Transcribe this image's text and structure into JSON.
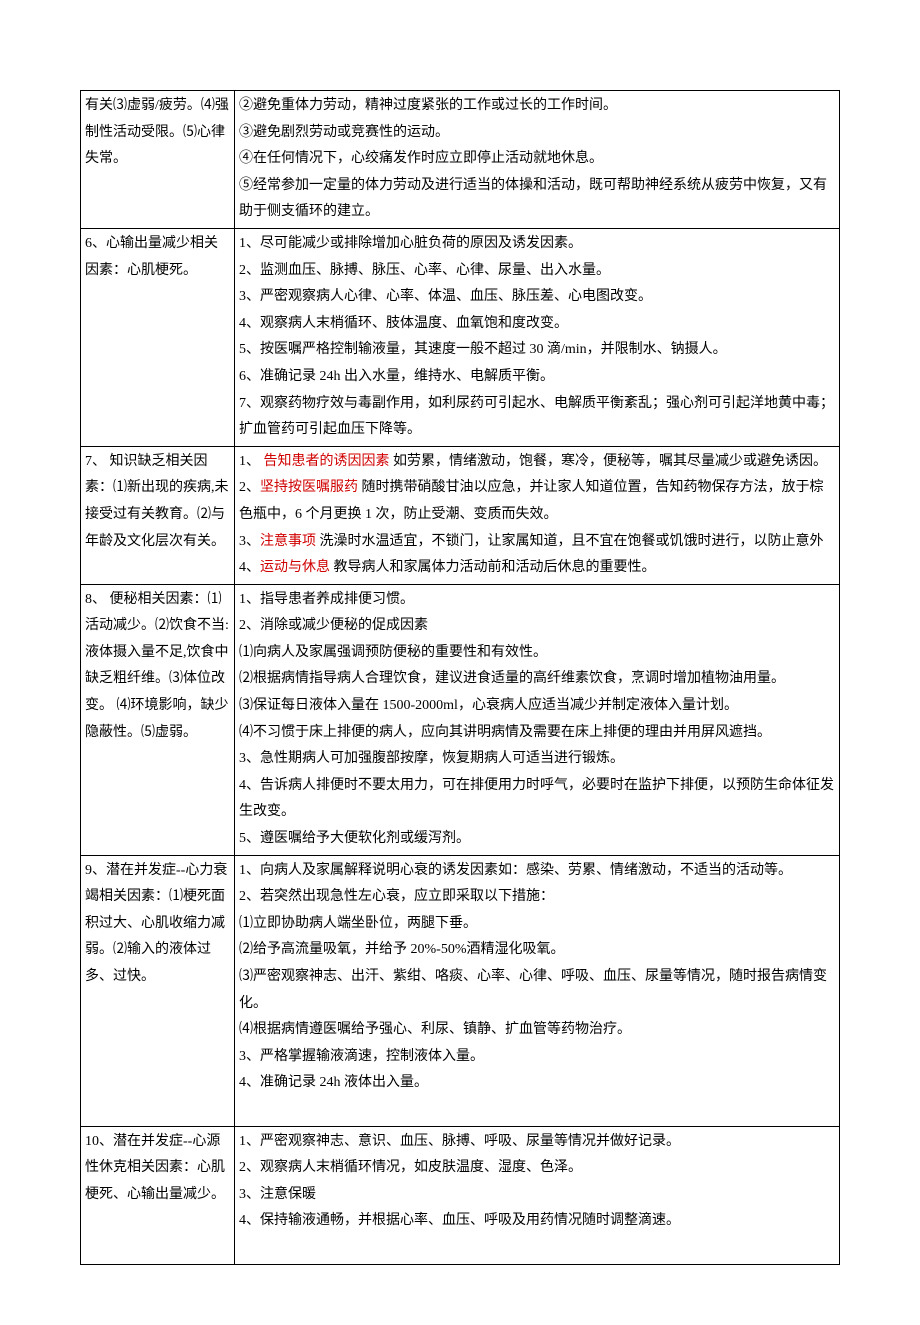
{
  "rows": [
    {
      "left": [
        "有关",
        "⑶虚弱/疲劳。",
        "⑷强制性活动受限。",
        "⑸心律失常。"
      ],
      "right": [
        {
          "segments": [
            {
              "t": "②避免重体力劳动，精神过度紧张的工作或过长的工作时间。"
            }
          ]
        },
        {
          "segments": [
            {
              "t": "③避免剧烈劳动或竞赛性的运动。"
            }
          ]
        },
        {
          "segments": [
            {
              "t": "④在任何情况下，心绞痛发作时应立即停止活动就地休息。"
            }
          ]
        },
        {
          "segments": [
            {
              "t": "⑤经常参加一定量的体力劳动及进行适当的体操和活动，既可帮助神经系统从疲劳中恢复，又有助于侧支循环的建立。"
            }
          ]
        }
      ]
    },
    {
      "left": [
        "6、心输出量减少",
        "相关因素：",
        "心肌梗死。"
      ],
      "right": [
        {
          "segments": [
            {
              "t": "1、尽可能减少或排除增加心脏负荷的原因及诱发因素。"
            }
          ]
        },
        {
          "segments": [
            {
              "t": "2、监测血压、脉搏、脉压、心率、心律、尿量、出入水量。"
            }
          ]
        },
        {
          "segments": [
            {
              "t": "3、严密观察病人心律、心率、体温、血压、脉压差、心电图改变。"
            }
          ]
        },
        {
          "segments": [
            {
              "t": "4、观察病人末梢循环、肢体温度、血氧饱和度改变。"
            }
          ]
        },
        {
          "segments": [
            {
              "t": "5、按医嘱严格控制输液量，其速度一般不超过 30 滴/min，并限制水、钠摄人。"
            }
          ]
        },
        {
          "segments": [
            {
              "t": "6、准确记录 24h 出入水量，维持水、电解质平衡。"
            }
          ]
        },
        {
          "segments": [
            {
              "t": "7、观察药物疗效与毒副作用，如利尿药可引起水、电解质平衡紊乱；强心剂可引起洋地黄中毒；扩血管药可引起血压下降等。"
            }
          ]
        }
      ]
    },
    {
      "left": [
        "7、 知识缺乏",
        "相关因素：",
        "⑴新出现的疾病,未接受过有关教育。",
        "⑵与年龄及文化层次有关。"
      ],
      "right": [
        {
          "segments": [
            {
              "t": "1、 "
            },
            {
              "t": "告知患者的诱因因素",
              "red": true
            },
            {
              "t": " 如劳累，情绪激动，饱餐，寒冷，便秘等，嘱其尽量减少或避免诱因。"
            }
          ]
        },
        {
          "segments": [
            {
              "t": "2、"
            },
            {
              "t": "坚持按医嘱服药",
              "red": true
            },
            {
              "t": " 随时携带硝酸甘油以应急，并让家人知道位置，告知药物保存方法，放于棕色瓶中，6 个月更换 1 次，防止受潮、变质而失效。"
            }
          ]
        },
        {
          "segments": [
            {
              "t": "3、"
            },
            {
              "t": "注意事项",
              "red": true
            },
            {
              "t": " 洗澡时水温适宜，不锁门，让家属知道，且不宜在饱餐或饥饿时进行，以防止意外"
            }
          ]
        },
        {
          "segments": [
            {
              "t": "4、"
            },
            {
              "t": "运动与休息",
              "red": true
            },
            {
              "t": " 教导病人和家属体力活动前和活动后休息的重要性。"
            }
          ]
        }
      ]
    },
    {
      "left": [
        "8、 便秘",
        "相关因素：",
        "⑴活动减少。",
        "⑵饮食不当: 液体摄入量不足,饮食中缺乏粗纤维。",
        "⑶体位改变。",
        " ⑷环境影响，缺少隐蔽性。",
        "⑸虚弱。",
        ""
      ],
      "right": [
        {
          "segments": [
            {
              "t": "1、指导患者养成排便习惯。"
            }
          ]
        },
        {
          "segments": [
            {
              "t": "2、消除或减少便秘的促成因素"
            }
          ]
        },
        {
          "segments": [
            {
              "t": "⑴向病人及家属强调预防便秘的重要性和有效性。"
            }
          ]
        },
        {
          "segments": [
            {
              "t": "⑵根据病情指导病人合理饮食，建议进食适量的高纤维素饮食，烹调时增加植物油用量。"
            }
          ]
        },
        {
          "segments": [
            {
              "t": "⑶保证每日液体入量在 1500-2000ml，心衰病人应适当减少并制定液体入量计划。"
            }
          ]
        },
        {
          "segments": [
            {
              "t": "⑷不习惯于床上排便的病人，应向其讲明病情及需要在床上排便的理由并用屏风遮挡。"
            }
          ]
        },
        {
          "segments": [
            {
              "t": "3、急性期病人可加强腹部按摩，恢复期病人可适当进行锻炼。"
            }
          ]
        },
        {
          "segments": [
            {
              "t": "4、告诉病人排便时不要太用力，可在排便用力时呼气，必要时在监护下排便，以预防生命体征发生改变。"
            }
          ]
        },
        {
          "segments": [
            {
              "t": "5、遵医嘱给予大便软化剂或缓泻剂。"
            }
          ]
        }
      ]
    },
    {
      "left": [
        "9、潜在并发症--心力衰竭",
        "相关因素：",
        "⑴梗死面积过大、心肌收缩力减弱。",
        "⑵输入的液体过多、过快。"
      ],
      "right": [
        {
          "segments": [
            {
              "t": "1、向病人及家属解释说明心衰的诱发因素如：感染、劳累、情绪激动，不适当的活动等。"
            }
          ]
        },
        {
          "segments": [
            {
              "t": "2、若突然出现急性左心衰，应立即采取以下措施："
            }
          ]
        },
        {
          "segments": [
            {
              "t": "⑴立即协助病人端坐卧位，两腿下垂。"
            }
          ]
        },
        {
          "segments": [
            {
              "t": "⑵给予高流量吸氧，并给予 20%-50%酒精湿化吸氧。"
            }
          ]
        },
        {
          "segments": [
            {
              "t": "⑶严密观察神志、出汗、紫绀、咯痰、心率、心律、呼吸、血压、尿量等情况，随时报告病情变化。"
            }
          ]
        },
        {
          "segments": [
            {
              "t": "⑷根据病情遵医嘱给予强心、利尿、镇静、扩血管等药物治疗。"
            }
          ]
        },
        {
          "segments": [
            {
              "t": "3、严格掌握输液滴速，控制液体入量。"
            }
          ]
        },
        {
          "segments": [
            {
              "t": "4、准确记录 24h 液体出入量。"
            }
          ]
        },
        {
          "segments": [
            {
              "t": ""
            }
          ]
        }
      ]
    },
    {
      "left": [
        "10、潜在并发症--心源性休克",
        "相关因素：",
        "心肌梗死、心输出量减少。"
      ],
      "right": [
        {
          "segments": [
            {
              "t": "1、严密观察神志、意识、血压、脉搏、呼吸、尿量等情况并做好记录。"
            }
          ]
        },
        {
          "segments": [
            {
              "t": "2、观察病人末梢循环情况，如皮肤温度、湿度、色泽。"
            }
          ]
        },
        {
          "segments": [
            {
              "t": "3、注意保暖"
            }
          ]
        },
        {
          "segments": [
            {
              "t": "4、保持输液通畅，并根据心率、血压、呼吸及用药情况随时调整滴速。"
            }
          ]
        },
        {
          "segments": [
            {
              "t": ""
            }
          ]
        }
      ]
    }
  ]
}
